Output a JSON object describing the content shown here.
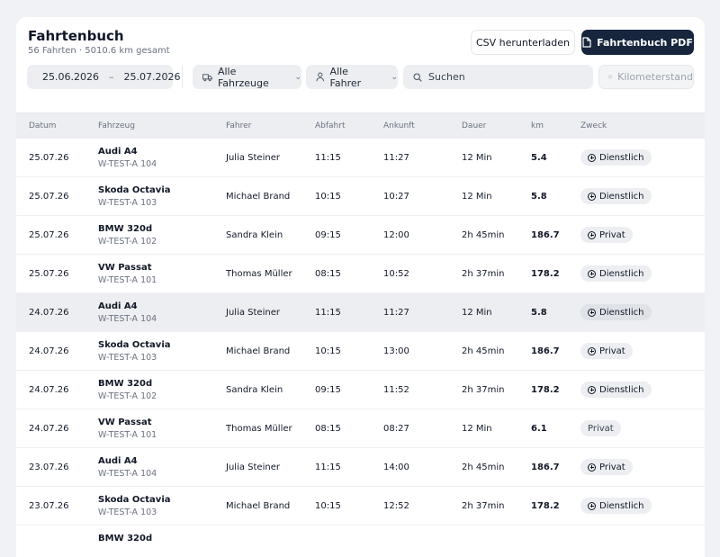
{
  "header": {
    "title": "Fahrtenbuch",
    "subtitle": "56 Fahrten · 5010.6 km gesamt",
    "csv_label": "CSV herunterladen",
    "pdf_label": "Fahrtenbuch PDF"
  },
  "filters": {
    "date_from": "25.06.2026",
    "date_sep": "–",
    "date_to": "25.07.2026",
    "vehicles": "Alle Fahrzeuge",
    "drivers": "Alle Fahrer",
    "search_placeholder": "Suchen",
    "odometer": "Kilometerstand"
  },
  "table": {
    "headers": [
      "Datum",
      "Fahrzeug",
      "Fahrer",
      "Abfahrt",
      "Ankunft",
      "Dauer",
      "km",
      "Zweck"
    ],
    "rows": [
      {
        "date": "25.07.26",
        "vehicle": "Audi A4",
        "plate": "W-TEST-A 104",
        "driver": "Julia Steiner",
        "dep": "11:15",
        "arr": "11:27",
        "dur": "12 Min",
        "km": "5.4",
        "purpose": "Dienstlich",
        "icon": true,
        "hl": false
      },
      {
        "date": "25.07.26",
        "vehicle": "Skoda Octavia",
        "plate": "W-TEST-A 103",
        "driver": "Michael Brand",
        "dep": "10:15",
        "arr": "10:27",
        "dur": "12 Min",
        "km": "5.8",
        "purpose": "Dienstlich",
        "icon": true,
        "hl": false
      },
      {
        "date": "25.07.26",
        "vehicle": "BMW 320d",
        "plate": "W-TEST-A 102",
        "driver": "Sandra Klein",
        "dep": "09:15",
        "arr": "12:00",
        "dur": "2h 45min",
        "km": "186.7",
        "purpose": "Privat",
        "icon": true,
        "hl": false
      },
      {
        "date": "25.07.26",
        "vehicle": "VW Passat",
        "plate": "W-TEST-A 101",
        "driver": "Thomas Müller",
        "dep": "08:15",
        "arr": "10:52",
        "dur": "2h 37min",
        "km": "178.2",
        "purpose": "Dienstlich",
        "icon": true,
        "hl": false
      },
      {
        "date": "24.07.26",
        "vehicle": "Audi A4",
        "plate": "W-TEST-A 104",
        "driver": "Julia Steiner",
        "dep": "11:15",
        "arr": "11:27",
        "dur": "12 Min",
        "km": "5.8",
        "purpose": "Dienstlich",
        "icon": true,
        "hl": true
      },
      {
        "date": "24.07.26",
        "vehicle": "Skoda Octavia",
        "plate": "W-TEST-A 103",
        "driver": "Michael Brand",
        "dep": "10:15",
        "arr": "13:00",
        "dur": "2h 45min",
        "km": "186.7",
        "purpose": "Privat",
        "icon": true,
        "hl": false
      },
      {
        "date": "24.07.26",
        "vehicle": "BMW 320d",
        "plate": "W-TEST-A 102",
        "driver": "Sandra Klein",
        "dep": "09:15",
        "arr": "11:52",
        "dur": "2h 37min",
        "km": "178.2",
        "purpose": "Dienstlich",
        "icon": true,
        "hl": false
      },
      {
        "date": "24.07.26",
        "vehicle": "VW Passat",
        "plate": "W-TEST-A 101",
        "driver": "Thomas Müller",
        "dep": "08:15",
        "arr": "08:27",
        "dur": "12 Min",
        "km": "6.1",
        "purpose": "Privat",
        "icon": false,
        "hl": false
      },
      {
        "date": "23.07.26",
        "vehicle": "Audi A4",
        "plate": "W-TEST-A 104",
        "driver": "Julia Steiner",
        "dep": "11:15",
        "arr": "14:00",
        "dur": "2h 45min",
        "km": "186.7",
        "purpose": "Privat",
        "icon": true,
        "hl": false
      },
      {
        "date": "23.07.26",
        "vehicle": "Skoda Octavia",
        "plate": "W-TEST-A 103",
        "driver": "Michael Brand",
        "dep": "10:15",
        "arr": "12:52",
        "dur": "2h 37min",
        "km": "178.2",
        "purpose": "Dienstlich",
        "icon": true,
        "hl": false
      },
      {
        "date": "",
        "vehicle": "BMW 320d",
        "plate": "",
        "driver": "",
        "dep": "",
        "arr": "",
        "dur": "",
        "km": "",
        "purpose": "",
        "icon": false,
        "hl": false
      }
    ]
  },
  "colors": {
    "primary_button": "#17253d",
    "surface": "#eceef1",
    "page_bg": "#f1f2f5"
  }
}
